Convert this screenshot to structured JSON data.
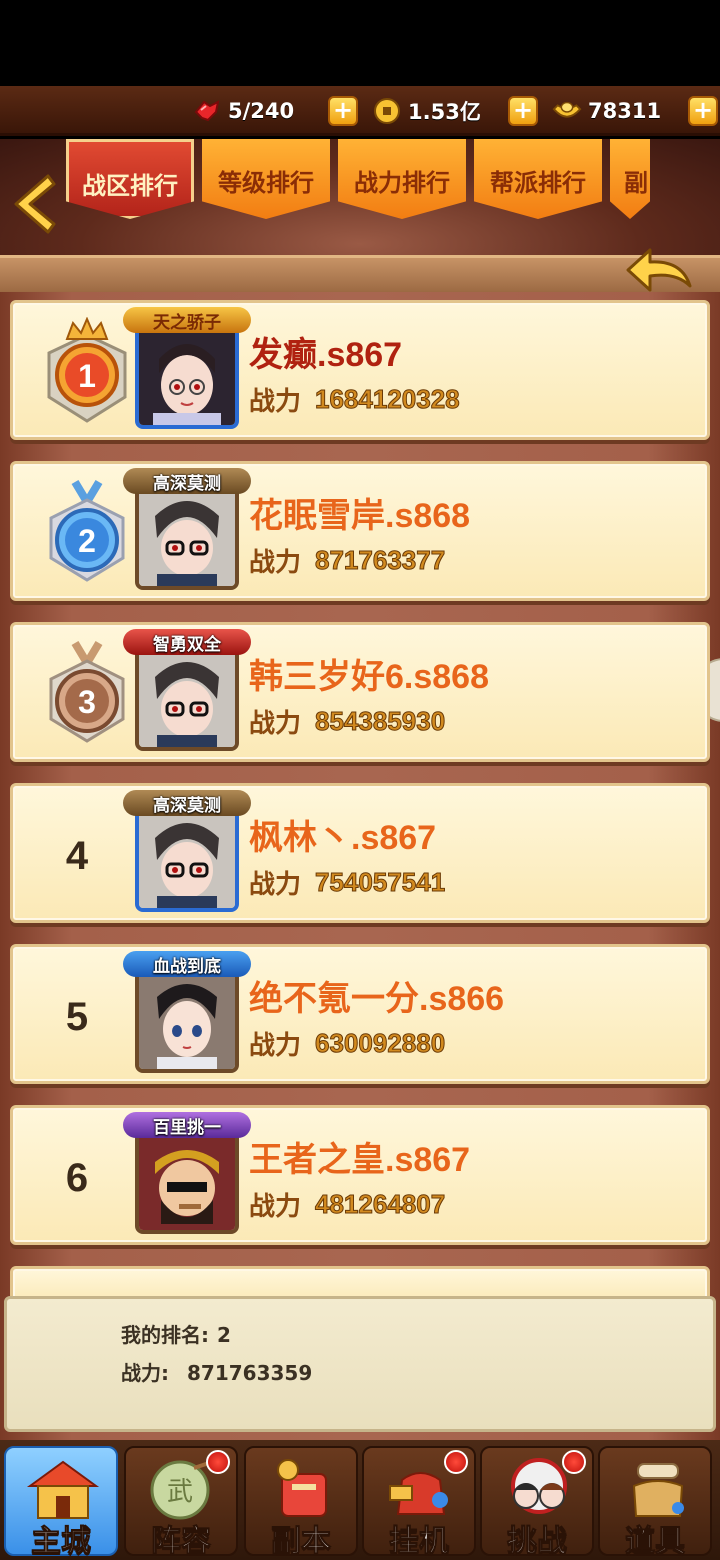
{
  "resources": [
    {
      "name": "stamina",
      "icon": "stamina-icon",
      "value": "5/240"
    },
    {
      "name": "coins",
      "icon": "coin-icon",
      "value": "1.53亿"
    },
    {
      "name": "gold",
      "icon": "gold-ingot-icon",
      "value": "78311"
    }
  ],
  "tabs": [
    {
      "label": "战区排行",
      "active": true
    },
    {
      "label": "等级排行",
      "active": false
    },
    {
      "label": "战力排行",
      "active": false
    },
    {
      "label": "帮派排行",
      "active": false
    },
    {
      "label": "副",
      "active": false
    }
  ],
  "power_label": "战力",
  "rankings": [
    {
      "rank": "1",
      "title": "天之骄子",
      "name": "发癫.s867",
      "power": "1684120328"
    },
    {
      "rank": "2",
      "title": "高深莫测",
      "name": "花眠雪岸.s868",
      "power": "871763377"
    },
    {
      "rank": "3",
      "title": "智勇双全",
      "name": "韩三岁好6.s868",
      "power": "854385930"
    },
    {
      "rank": "4",
      "title": "高深莫测",
      "name": "枫林丶.s867",
      "power": "754057541"
    },
    {
      "rank": "5",
      "title": "血战到底",
      "name": "绝不氪一分.s866",
      "power": "630092880"
    },
    {
      "rank": "6",
      "title": "百里挑一",
      "name": "王者之皇.s867",
      "power": "481264807"
    }
  ],
  "my_rank": {
    "rank_label": "我的排名:",
    "rank_value": "2",
    "power_label": "战力:",
    "power_value": "871763359"
  },
  "nav": [
    {
      "label": "主城",
      "icon": "city-icon",
      "active": true,
      "badge": false
    },
    {
      "label": "阵容",
      "icon": "formation-icon",
      "active": false,
      "badge": true
    },
    {
      "label": "副本",
      "icon": "dungeon-icon",
      "active": false,
      "badge": false
    },
    {
      "label": "挂机",
      "icon": "idle-icon",
      "active": false,
      "badge": true
    },
    {
      "label": "挑战",
      "icon": "challenge-icon",
      "active": false,
      "badge": true
    },
    {
      "label": "道具",
      "icon": "items-icon",
      "active": false,
      "badge": false
    }
  ]
}
